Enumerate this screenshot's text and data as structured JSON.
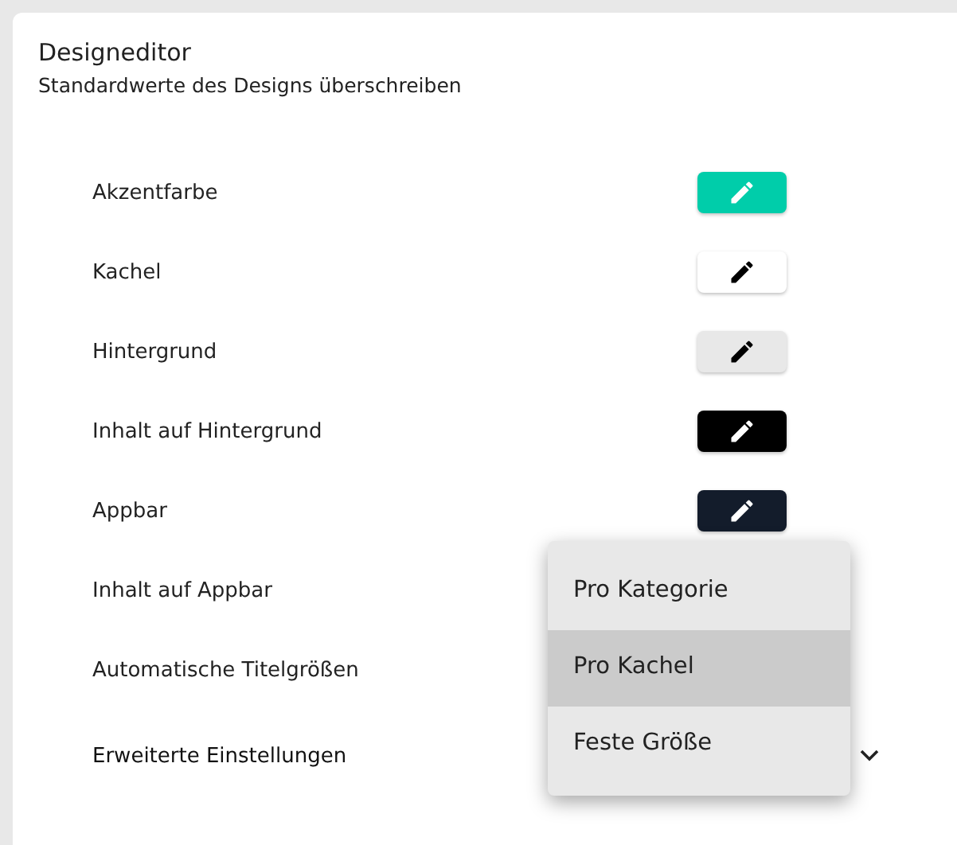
{
  "panel": {
    "title": "Designeditor",
    "subtitle": "Standardwerte des Designs überschreiben"
  },
  "settings": [
    {
      "kind": "color",
      "label": "Akzentfarbe",
      "color": "#00cdaa"
    },
    {
      "kind": "color",
      "label": "Kachel",
      "color": "#ffffff"
    },
    {
      "kind": "color",
      "label": "Hintergrund",
      "color": "#e8e8e8"
    },
    {
      "kind": "color",
      "label": "Inhalt auf Hintergrund",
      "color": "#000000"
    },
    {
      "kind": "color",
      "label": "Appbar",
      "color": "#131c2b"
    },
    {
      "kind": "plain",
      "label": "Inhalt auf Appbar"
    },
    {
      "kind": "plain",
      "label": "Automatische Titelgrößen"
    },
    {
      "kind": "expander",
      "label": "Erweiterte Einstellungen",
      "expanded": false
    }
  ],
  "menu": [
    {
      "label": "Pro Kategorie",
      "selected": false
    },
    {
      "label": "Pro Kachel",
      "selected": true
    },
    {
      "label": "Feste Größe",
      "selected": false
    }
  ]
}
